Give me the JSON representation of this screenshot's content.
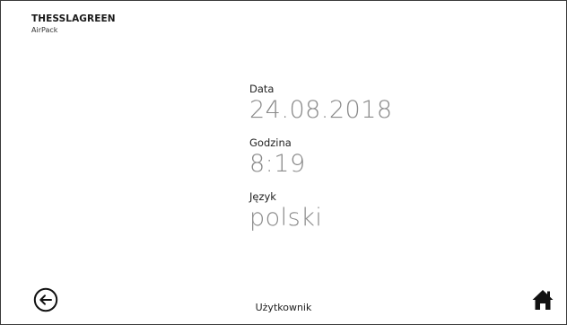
{
  "header": {
    "brand": "THESSLAGREEN",
    "product": "AirPack"
  },
  "settings": {
    "date": {
      "label": "Data",
      "value": "24.08.2018"
    },
    "time": {
      "label": "Godzina",
      "value": "8:19"
    },
    "language": {
      "label": "Język",
      "value": "polski"
    }
  },
  "footer": {
    "title": "Użytkownik",
    "back_icon": "arrow-left-circle-icon",
    "home_icon": "home-icon"
  },
  "colors": {
    "value_text": "#8a8a8a",
    "label_text": "#222222",
    "border": "#3a3a3a"
  }
}
